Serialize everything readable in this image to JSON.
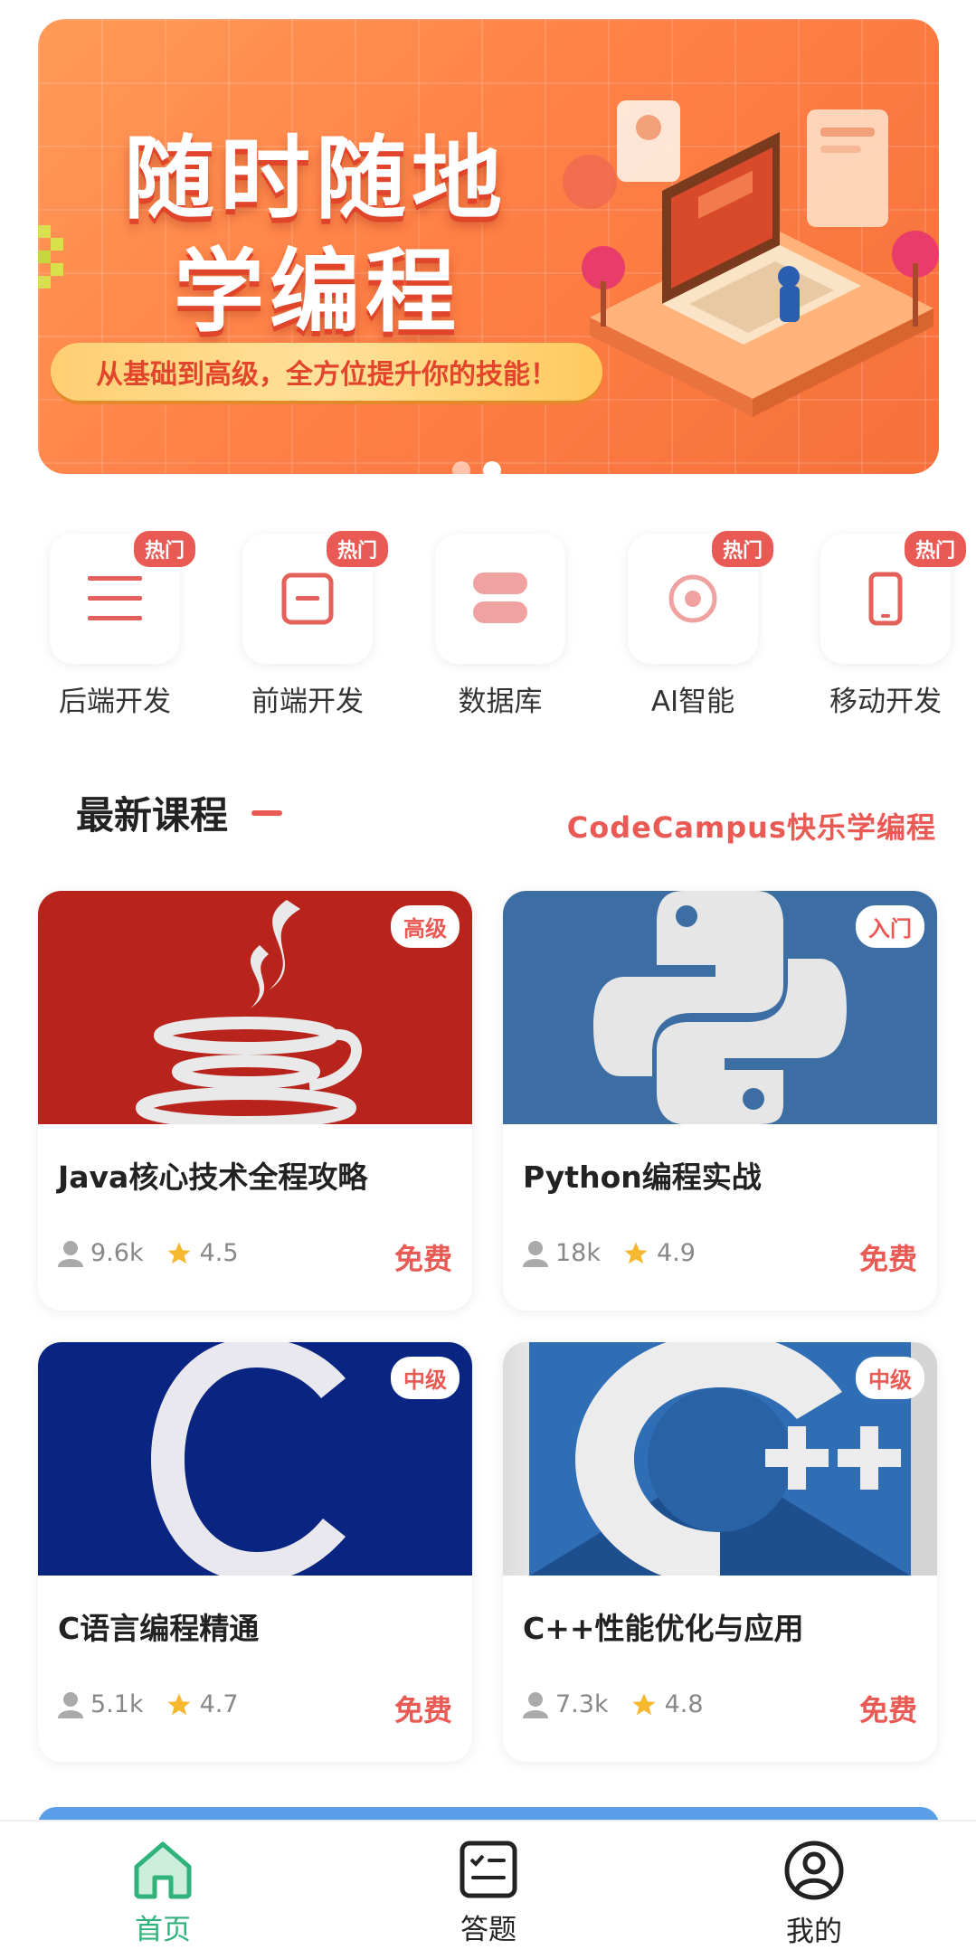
{
  "banner": {
    "title_line1": "随时随地",
    "title_line2": "学编程",
    "slogan": "从基础到高级，全方位提升你的技能！"
  },
  "categories": [
    {
      "label": "后端开发",
      "badge": "热门",
      "icon": "menu-lines-icon"
    },
    {
      "label": "前端开发",
      "badge": "热门",
      "icon": "minus-square-icon"
    },
    {
      "label": "数据库",
      "badge": "",
      "icon": "database-icon"
    },
    {
      "label": "AI智能",
      "badge": "热门",
      "icon": "target-icon"
    },
    {
      "label": "移动开发",
      "badge": "热门",
      "icon": "phone-icon"
    }
  ],
  "section": {
    "title": "最新课程",
    "subtitle": "CodeCampus快乐学编程"
  },
  "courses": [
    {
      "title": "Java核心技术全程攻略",
      "level": "高级",
      "students": "9.6k",
      "rating": "4.5",
      "price": "免费",
      "thumb_color": "#b8231b"
    },
    {
      "title": "Python编程实战",
      "level": "入门",
      "students": "18k",
      "rating": "4.9",
      "price": "免费",
      "thumb_color": "#3d6ea3"
    },
    {
      "title": "C语言编程精通",
      "level": "中级",
      "students": "5.1k",
      "rating": "4.7",
      "price": "免费",
      "thumb_color": "#0a2482"
    },
    {
      "title": "C++性能优化与应用",
      "level": "中级",
      "students": "7.3k",
      "rating": "4.8",
      "price": "免费",
      "thumb_color": "#2f6db5"
    }
  ],
  "nav": [
    {
      "label": "首页",
      "icon": "home-icon",
      "active": true
    },
    {
      "label": "答题",
      "icon": "checklist-icon",
      "active": false
    },
    {
      "label": "我的",
      "icon": "user-circle-icon",
      "active": false
    }
  ],
  "colors": {
    "accent": "#ea5a55",
    "nav_active": "#2fb37a",
    "banner": "#ff8147"
  }
}
